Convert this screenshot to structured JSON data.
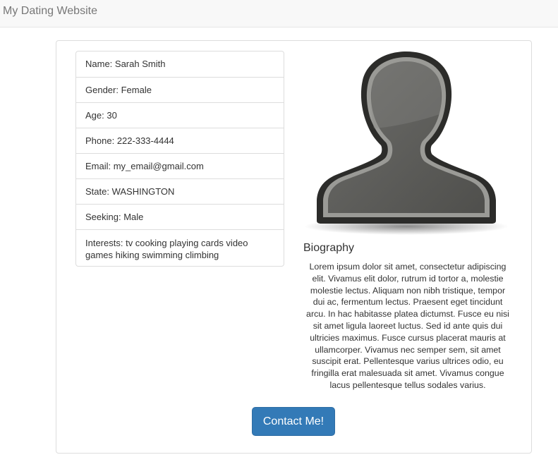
{
  "navbar": {
    "brand": "My Dating Website"
  },
  "profile": {
    "fields": [
      "Name: Sarah Smith",
      "Gender: Female",
      "Age: 30",
      "Phone: 222-333-4444",
      "Email: my_email@gmail.com",
      "State: WASHINGTON",
      "Seeking: Male",
      "Interests: tv cooking playing cards video games hiking swimming climbing"
    ],
    "avatar_icon": "user-silhouette-icon"
  },
  "biography": {
    "title": "Biography",
    "text": "Lorem ipsum dolor sit amet, consectetur adipiscing elit. Vivamus elit dolor, rutrum id tortor a, molestie molestie lectus. Aliquam non nibh tristique, tempor dui ac, fermentum lectus. Praesent eget tincidunt arcu. In hac habitasse platea dictumst. Fusce eu nisi sit amet ligula laoreet luctus. Sed id ante quis dui ultricies maximus. Fusce cursus placerat mauris at ullamcorper. Vivamus nec semper sem, sit amet suscipit erat. Pellentesque varius ultrices odio, eu fringilla erat malesuada sit amet. Vivamus congue lacus pellentesque tellus sodales varius."
  },
  "actions": {
    "contact_label": "Contact Me!"
  },
  "colors": {
    "primary": "#337ab7",
    "navbar_bg": "#f8f8f8",
    "border": "#dddddd"
  }
}
